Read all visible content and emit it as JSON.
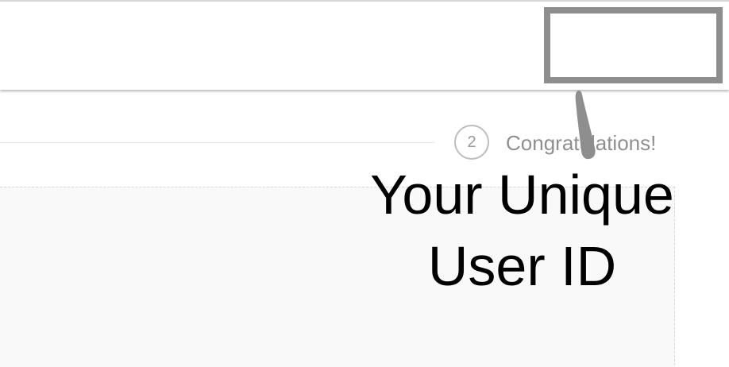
{
  "steps": {
    "current_number": "2",
    "current_label": "Congratulations!"
  },
  "annotation": {
    "line1": "Your Unique",
    "line2": "User ID",
    "pointer_color": "#8e8e8e"
  },
  "colors": {
    "highlight_border": "#8e8e8e",
    "panel_background": "#f9f9f9",
    "step_text": "#8f8f8f"
  }
}
